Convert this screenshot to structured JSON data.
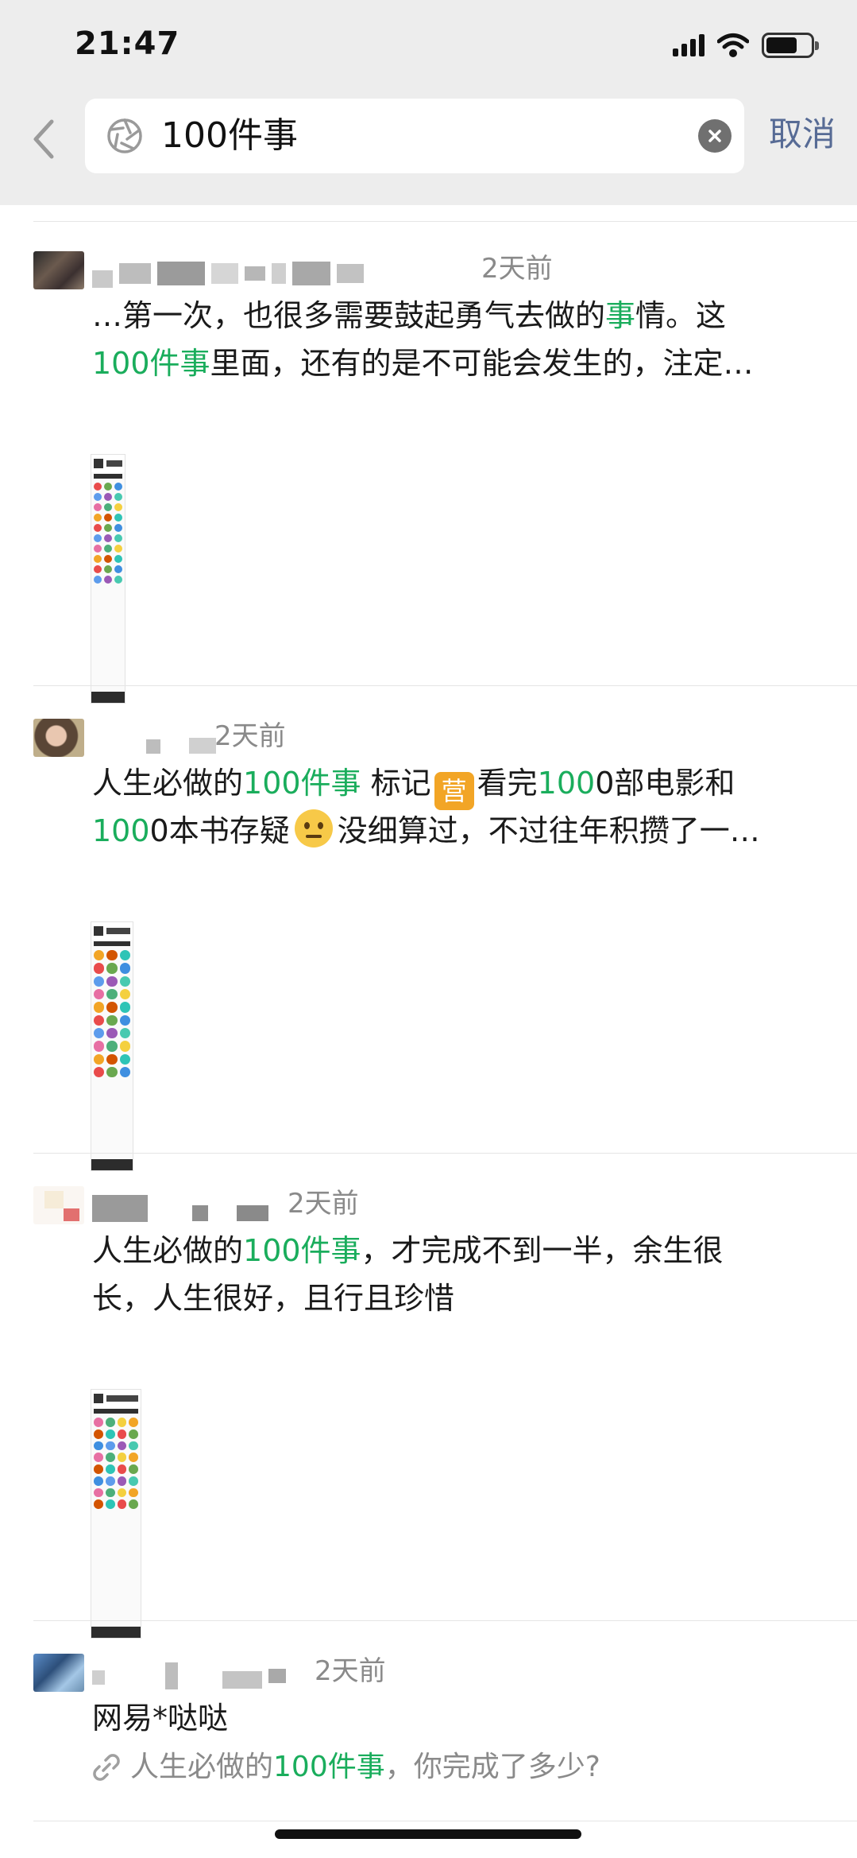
{
  "status_bar": {
    "time": "21:47",
    "battery_level": 0.7
  },
  "search": {
    "query": "100件事",
    "cancel_label": "取消",
    "icons": {
      "back": "chevron-left-icon",
      "lens": "camera-aperture-icon",
      "clear": "clear-x-icon"
    }
  },
  "posts": [
    {
      "time": "2天前",
      "text_line1": {
        "a": "…第一次，也很多需要鼓起勇气去做的",
        "b": "事",
        "c": "情。这"
      },
      "text_line2": {
        "a": "100件事",
        "b": "里面，还有的是不可能会发生的，注定…"
      }
    },
    {
      "time": "2天前",
      "text_line1": {
        "a": "人生必做的",
        "b": "100件事",
        "c": " 标记",
        "d": "看完",
        "e": "100",
        "f": "0部电影和"
      },
      "text_line2": {
        "a": "100",
        "b": "0本书存疑",
        "c": "没细算过，不过往年积攒了一…"
      },
      "badge_char": "营"
    },
    {
      "time": "2天前",
      "text_line1": {
        "a": "人生必做的",
        "b": "100件事",
        "c": "，才完成不到一半，余生很"
      },
      "text_line2": "长，人生很好，且行且珍惜"
    },
    {
      "time": "2天前",
      "text": "网易*哒哒",
      "link": {
        "a": "人生必做的",
        "b": "100件事",
        "c": "，你完成了多少?"
      },
      "link_icon": "link-icon"
    }
  ],
  "colors": {
    "highlight": "#1aad5c",
    "cancel": "#576b95",
    "header_bg": "#ededed"
  }
}
